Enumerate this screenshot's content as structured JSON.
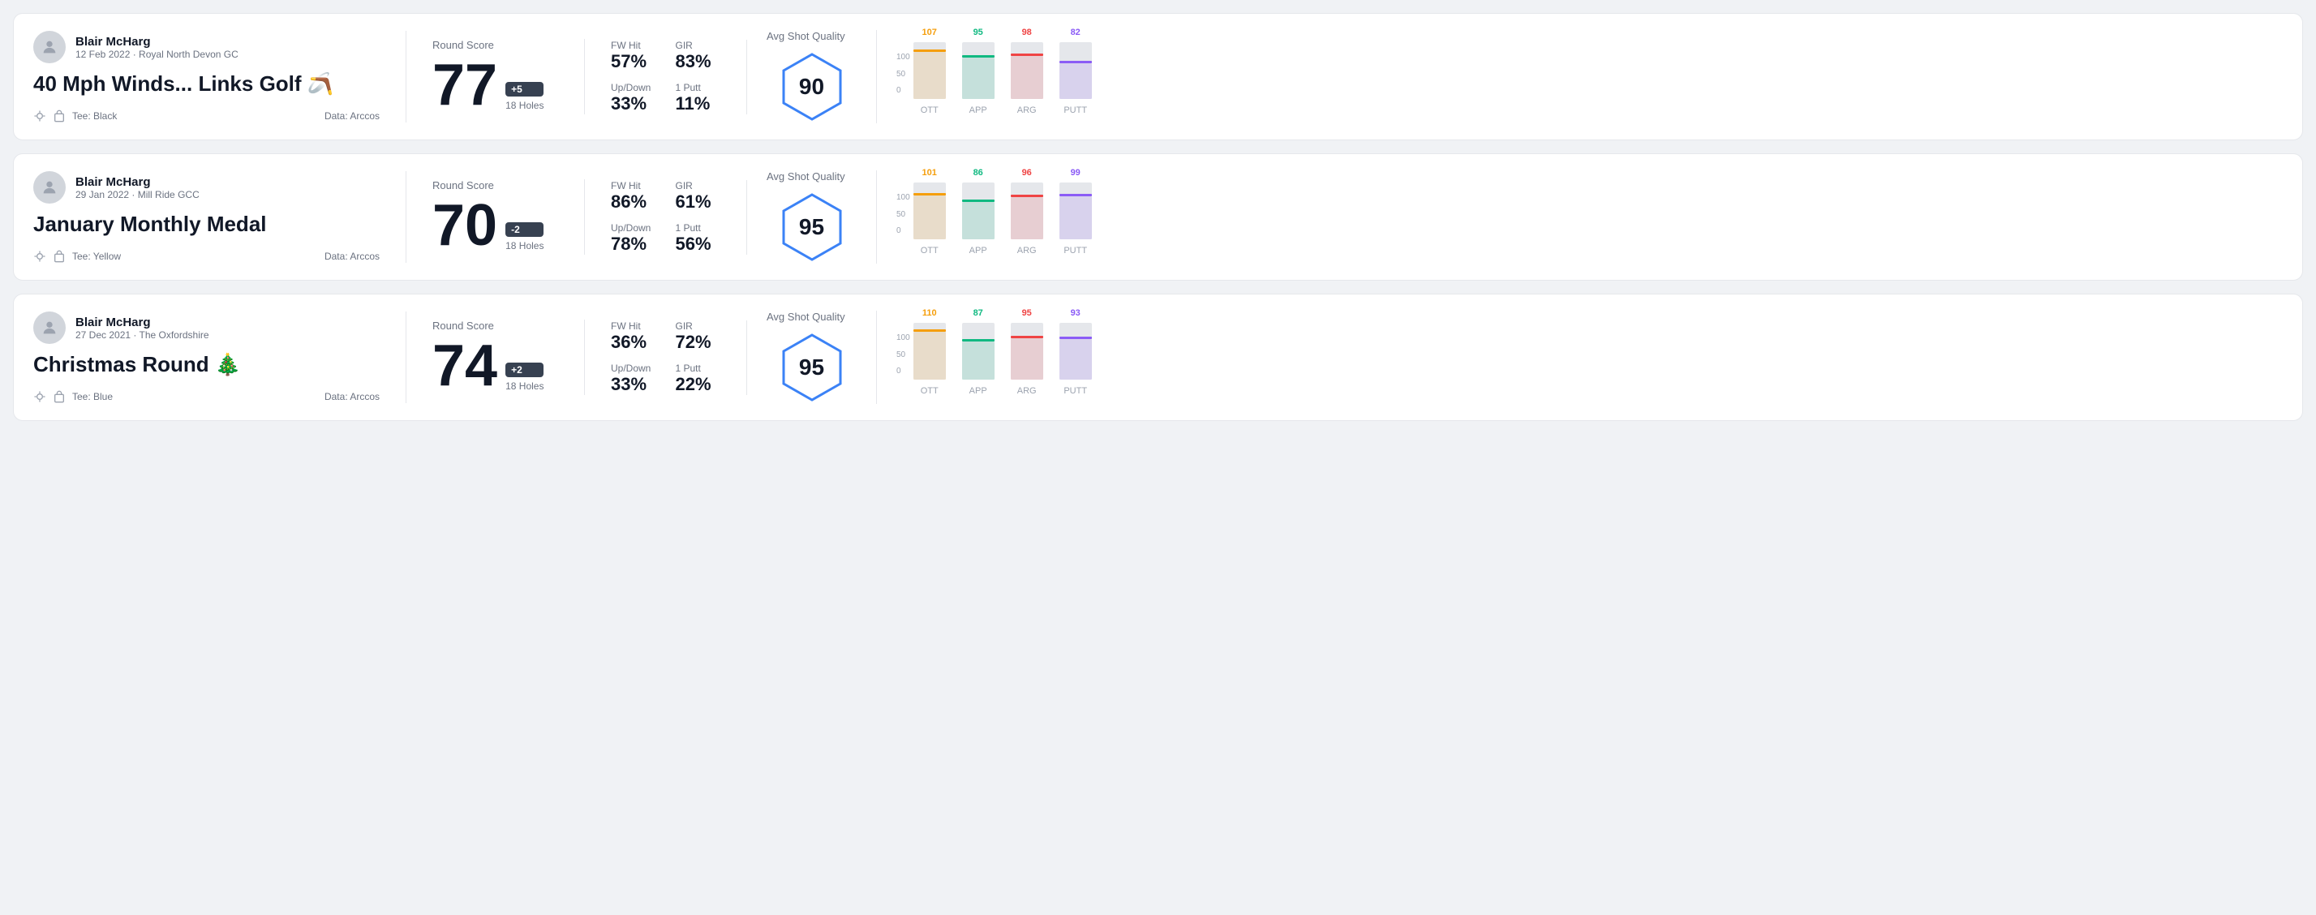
{
  "rounds": [
    {
      "id": "round1",
      "user": {
        "name": "Blair McHarg",
        "date_course": "12 Feb 2022 · Royal North Devon GC"
      },
      "title": "40 Mph Winds... Links Golf 🪃",
      "tee": "Black",
      "data_source": "Data: Arccos",
      "round_score_label": "Round Score",
      "score": "77",
      "badge": "+5",
      "holes": "18 Holes",
      "fw_hit_label": "FW Hit",
      "fw_hit": "57%",
      "gir_label": "GIR",
      "gir": "83%",
      "updown_label": "Up/Down",
      "updown": "33%",
      "oneputt_label": "1 Putt",
      "oneputt": "11%",
      "quality_label": "Avg Shot Quality",
      "quality_score": "90",
      "bars": [
        {
          "label": "OTT",
          "value": 107,
          "color": "#f59e0b"
        },
        {
          "label": "APP",
          "value": 95,
          "color": "#10b981"
        },
        {
          "label": "ARG",
          "value": 98,
          "color": "#ef4444"
        },
        {
          "label": "PUTT",
          "value": 82,
          "color": "#8b5cf6"
        }
      ]
    },
    {
      "id": "round2",
      "user": {
        "name": "Blair McHarg",
        "date_course": "29 Jan 2022 · Mill Ride GCC"
      },
      "title": "January Monthly Medal",
      "tee": "Yellow",
      "data_source": "Data: Arccos",
      "round_score_label": "Round Score",
      "score": "70",
      "badge": "-2",
      "holes": "18 Holes",
      "fw_hit_label": "FW Hit",
      "fw_hit": "86%",
      "gir_label": "GIR",
      "gir": "61%",
      "updown_label": "Up/Down",
      "updown": "78%",
      "oneputt_label": "1 Putt",
      "oneputt": "56%",
      "quality_label": "Avg Shot Quality",
      "quality_score": "95",
      "bars": [
        {
          "label": "OTT",
          "value": 101,
          "color": "#f59e0b"
        },
        {
          "label": "APP",
          "value": 86,
          "color": "#10b981"
        },
        {
          "label": "ARG",
          "value": 96,
          "color": "#ef4444"
        },
        {
          "label": "PUTT",
          "value": 99,
          "color": "#8b5cf6"
        }
      ]
    },
    {
      "id": "round3",
      "user": {
        "name": "Blair McHarg",
        "date_course": "27 Dec 2021 · The Oxfordshire"
      },
      "title": "Christmas Round 🎄",
      "tee": "Blue",
      "data_source": "Data: Arccos",
      "round_score_label": "Round Score",
      "score": "74",
      "badge": "+2",
      "holes": "18 Holes",
      "fw_hit_label": "FW Hit",
      "fw_hit": "36%",
      "gir_label": "GIR",
      "gir": "72%",
      "updown_label": "Up/Down",
      "updown": "33%",
      "oneputt_label": "1 Putt",
      "oneputt": "22%",
      "quality_label": "Avg Shot Quality",
      "quality_score": "95",
      "bars": [
        {
          "label": "OTT",
          "value": 110,
          "color": "#f59e0b"
        },
        {
          "label": "APP",
          "value": 87,
          "color": "#10b981"
        },
        {
          "label": "ARG",
          "value": 95,
          "color": "#ef4444"
        },
        {
          "label": "PUTT",
          "value": 93,
          "color": "#8b5cf6"
        }
      ]
    }
  ]
}
